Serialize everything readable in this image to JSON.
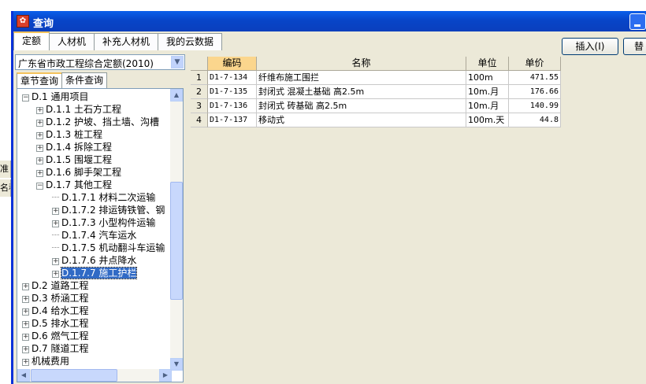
{
  "window": {
    "title": "查询",
    "icon": "app-logo-icon"
  },
  "main_tabs": [
    {
      "label": "定额",
      "active": true
    },
    {
      "label": "人材机",
      "active": false
    },
    {
      "label": "补充人材机",
      "active": false
    },
    {
      "label": "我的云数据",
      "active": false
    }
  ],
  "toolbar": {
    "insert_label": "插入(I)",
    "replace_label": "替"
  },
  "background_fragments": [
    "准",
    "名称"
  ],
  "quota_selector": {
    "value": "广东省市政工程综合定额(2010)"
  },
  "sub_tabs": [
    {
      "label": "章节查询",
      "active": true
    },
    {
      "label": "条件查询",
      "active": false
    }
  ],
  "tree": [
    {
      "label": "D.1 通用项目",
      "expander": "−"
    },
    {
      "label": "D.1.1 土石方工程",
      "expander": "+"
    },
    {
      "label": "D.1.2 护坡、挡土墙、沟槽",
      "expander": "+"
    },
    {
      "label": "D.1.3 桩工程",
      "expander": "+"
    },
    {
      "label": "D.1.4 拆除工程",
      "expander": "+"
    },
    {
      "label": "D.1.5 围堰工程",
      "expander": "+"
    },
    {
      "label": "D.1.6 脚手架工程",
      "expander": "+"
    },
    {
      "label": "D.1.7 其他工程",
      "expander": "−"
    },
    {
      "label": "D.1.7.1 材料二次运输",
      "expander": ""
    },
    {
      "label": "D.1.7.2 排运铸铁管、钢",
      "expander": "+"
    },
    {
      "label": "D.1.7.3 小型构件运输",
      "expander": "+"
    },
    {
      "label": "D.1.7.4 汽车运水",
      "expander": ""
    },
    {
      "label": "D.1.7.5 机动翻斗车运输",
      "expander": ""
    },
    {
      "label": "D.1.7.6 井点降水",
      "expander": "+"
    },
    {
      "label": "D.1.7.7 施工护栏",
      "expander": "+",
      "selected": true
    },
    {
      "label": "D.2 道路工程",
      "expander": "+"
    },
    {
      "label": "D.3 桥涵工程",
      "expander": "+"
    },
    {
      "label": "D.4 给水工程",
      "expander": "+"
    },
    {
      "label": "D.5 排水工程",
      "expander": "+"
    },
    {
      "label": "D.6 燃气工程",
      "expander": "+"
    },
    {
      "label": "D.7 隧道工程",
      "expander": "+"
    },
    {
      "label": "机械费用",
      "expander": "+"
    }
  ],
  "grid": {
    "headers": {
      "code": "编码",
      "name": "名称",
      "unit": "单位",
      "price": "单价"
    },
    "rows": [
      {
        "num": "1",
        "code": "D1-7-134",
        "name": "纤维布施工围拦",
        "unit": "100m",
        "price": "471.55"
      },
      {
        "num": "2",
        "code": "D1-7-135",
        "name": "封闭式 混凝土基础 高2.5m",
        "unit": "10m.月",
        "price": "176.66"
      },
      {
        "num": "3",
        "code": "D1-7-136",
        "name": "封闭式 砖基础 高2.5m",
        "unit": "10m.月",
        "price": "140.99"
      },
      {
        "num": "4",
        "code": "D1-7-137",
        "name": "移动式",
        "unit": "100m.天",
        "price": "44.8"
      }
    ]
  },
  "colors": {
    "titlebar": "#0845c8",
    "selection": "#316ac5",
    "header_selected": "#fbd68d",
    "tab_accent": "#f4c25b"
  }
}
